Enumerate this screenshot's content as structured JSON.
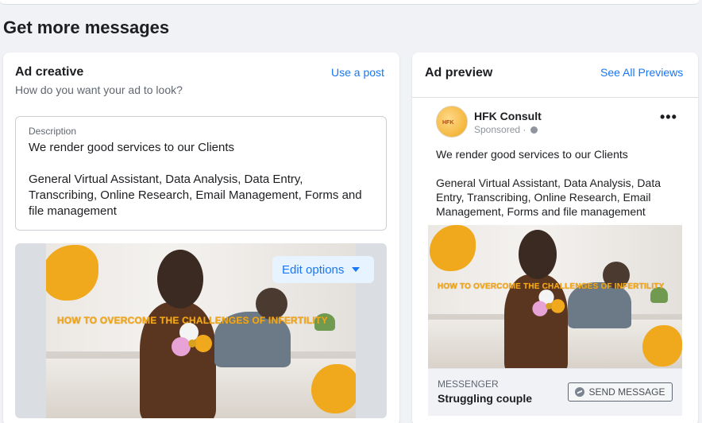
{
  "page": {
    "title": "Get more messages"
  },
  "ad_creative": {
    "title": "Ad creative",
    "subtitle": "How do you want your ad to look?",
    "use_post_link": "Use a post",
    "description": {
      "label": "Description",
      "value": "We render good services to our Clients\n\nGeneral Virtual Assistant, Data Analysis, Data Entry, Transcribing, Online Research, Email Management, Forms and file management"
    },
    "media": {
      "headline": "HOW TO OVERCOME THE CHALLENGES OF INFERTILITY",
      "edit_options_label": "Edit options"
    }
  },
  "ad_preview": {
    "title": "Ad preview",
    "see_all_link": "See All Previews",
    "post": {
      "page_name": "HFK Consult",
      "avatar_text": "HFK",
      "sponsored_label": "Sponsored · ",
      "text": "We render good services to our Clients\n\nGeneral Virtual Assistant, Data Analysis, Data Entry, Transcribing, Online Research, Email Management, Forms and file management",
      "media_headline": "HOW TO OVERCOME THE CHALLENGES OF INFERTILITY",
      "cta": {
        "kicker": "MESSENGER",
        "title": "Struggling couple",
        "button_label": "SEND MESSAGE"
      }
    }
  },
  "colors": {
    "accent": "#1877f2",
    "brand_orange": "#f0a81c",
    "background": "#f0f2f5"
  }
}
